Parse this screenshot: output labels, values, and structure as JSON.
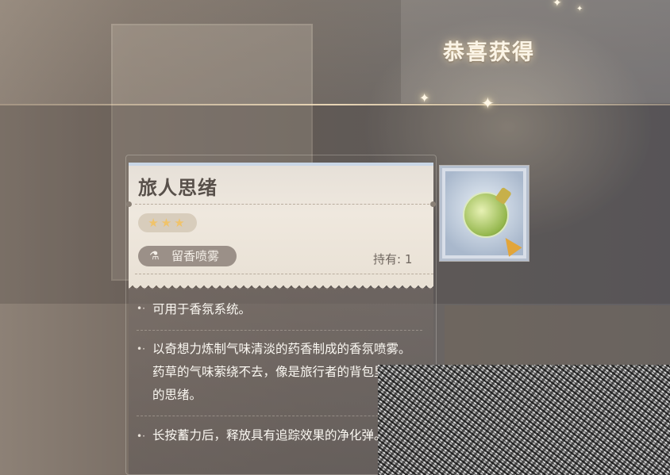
{
  "header": {
    "title": "恭喜获得"
  },
  "item": {
    "name": "旅人思绪",
    "stars": "★★★",
    "type_icon": "flask-icon",
    "type_label": "留香喷雾",
    "owned_label": "持有:",
    "owned_value": "1",
    "descriptions": [
      "可用于香氛系统。",
      "以奇想力炼制气味清淡的药香制成的香氛喷雾。药草的气味萦绕不去，像是旅行者的背包里承载的思绪。",
      "长按蓄力后，释放具有追踪效果的净化弹。"
    ]
  },
  "colors": {
    "accent": "#f0c36a",
    "card_head": "#efe8de",
    "type_pill": "#9b9088"
  }
}
